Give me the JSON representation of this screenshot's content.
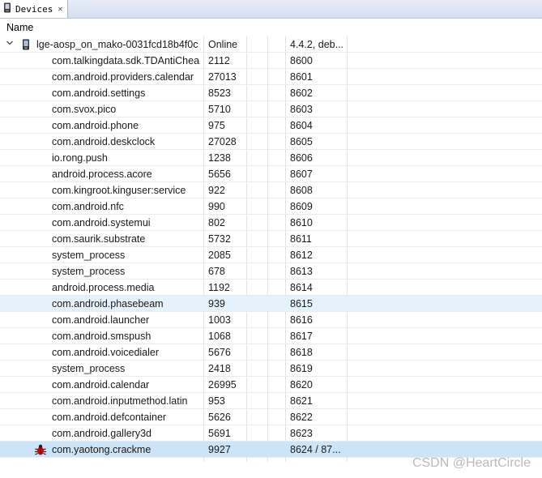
{
  "tab": {
    "label": "Devices",
    "close_glyph": "✕"
  },
  "header": {
    "name_col": "Name"
  },
  "device": {
    "name": "lge-aosp_on_mako-0031fcd18b4f0c",
    "state": "Online",
    "build": "4.4.2, deb..."
  },
  "processes": [
    {
      "name": "com.talkingdata.sdk.TDAntiChea",
      "pid": "2112",
      "port": "8600"
    },
    {
      "name": "com.android.providers.calendar",
      "pid": "27013",
      "port": "8601"
    },
    {
      "name": "com.android.settings",
      "pid": "8523",
      "port": "8602"
    },
    {
      "name": "com.svox.pico",
      "pid": "5710",
      "port": "8603"
    },
    {
      "name": "com.android.phone",
      "pid": "975",
      "port": "8604"
    },
    {
      "name": "com.android.deskclock",
      "pid": "27028",
      "port": "8605"
    },
    {
      "name": "io.rong.push",
      "pid": "1238",
      "port": "8606"
    },
    {
      "name": "android.process.acore",
      "pid": "5656",
      "port": "8607"
    },
    {
      "name": "com.kingroot.kinguser:service",
      "pid": "922",
      "port": "8608"
    },
    {
      "name": "com.android.nfc",
      "pid": "990",
      "port": "8609"
    },
    {
      "name": "com.android.systemui",
      "pid": "802",
      "port": "8610"
    },
    {
      "name": "com.saurik.substrate",
      "pid": "5732",
      "port": "8611"
    },
    {
      "name": "system_process",
      "pid": "2085",
      "port": "8612"
    },
    {
      "name": "system_process",
      "pid": "678",
      "port": "8613"
    },
    {
      "name": "android.process.media",
      "pid": "1192",
      "port": "8614"
    },
    {
      "name": "com.android.phasebeam",
      "pid": "939",
      "port": "8615"
    },
    {
      "name": "com.android.launcher",
      "pid": "1003",
      "port": "8616"
    },
    {
      "name": "com.android.smspush",
      "pid": "1068",
      "port": "8617"
    },
    {
      "name": "com.android.voicedialer",
      "pid": "5676",
      "port": "8618"
    },
    {
      "name": "system_process",
      "pid": "2418",
      "port": "8619"
    },
    {
      "name": "com.android.calendar",
      "pid": "26995",
      "port": "8620"
    },
    {
      "name": "com.android.inputmethod.latin",
      "pid": "953",
      "port": "8621"
    },
    {
      "name": "com.android.defcontainer",
      "pid": "5626",
      "port": "8622"
    },
    {
      "name": "com.android.gallery3d",
      "pid": "5691",
      "port": "8623"
    },
    {
      "name": "com.yaotong.crackme",
      "pid": "9927",
      "port": "8624 / 87..."
    }
  ],
  "hover_index": 15,
  "selected_index": 24,
  "debug_icon": "bug-icon",
  "watermark": "CSDN @HeartCircle",
  "colors": {
    "hover": "#e5f1fb",
    "selected": "#cce4f7",
    "bug": "#d40000"
  }
}
